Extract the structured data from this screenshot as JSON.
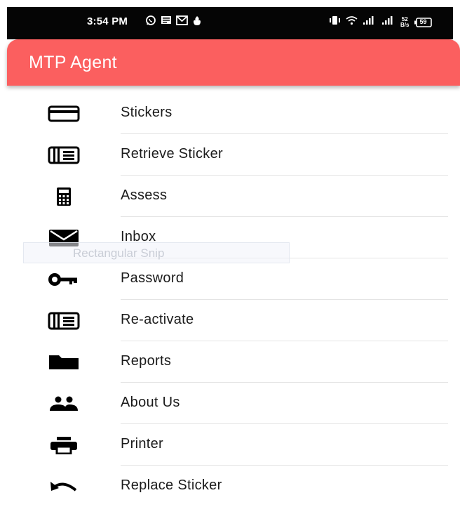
{
  "status_bar": {
    "time": "3:54 PM",
    "left_icons": [
      "whatsapp-icon",
      "message-icon",
      "gmail-icon",
      "flame-icon"
    ],
    "right_icons": [
      "vibrate-icon",
      "wifi-icon",
      "signal-1-icon",
      "signal-2-icon",
      "battery-icon"
    ],
    "speed_value": "52",
    "speed_unit": "B/s",
    "battery_level": "59"
  },
  "app_bar": {
    "title": "MTP Agent",
    "color": "#fb5f5f"
  },
  "menu": {
    "items": [
      {
        "label": "Stickers",
        "icon": "credit-card-icon"
      },
      {
        "label": "Retrieve Sticker",
        "icon": "chrome-reader-icon"
      },
      {
        "label": "Assess",
        "icon": "calculator-icon"
      },
      {
        "label": "Inbox",
        "icon": "mail-icon"
      },
      {
        "label": "Password",
        "icon": "key-icon"
      },
      {
        "label": "Re-activate",
        "icon": "chrome-reader-icon"
      },
      {
        "label": "Reports",
        "icon": "folder-icon"
      },
      {
        "label": "About Us",
        "icon": "people-icon"
      },
      {
        "label": "Printer",
        "icon": "printer-icon"
      },
      {
        "label": "Replace Sticker",
        "icon": "undo-icon"
      }
    ]
  },
  "overlay": {
    "label": "Rectangular Snip"
  }
}
